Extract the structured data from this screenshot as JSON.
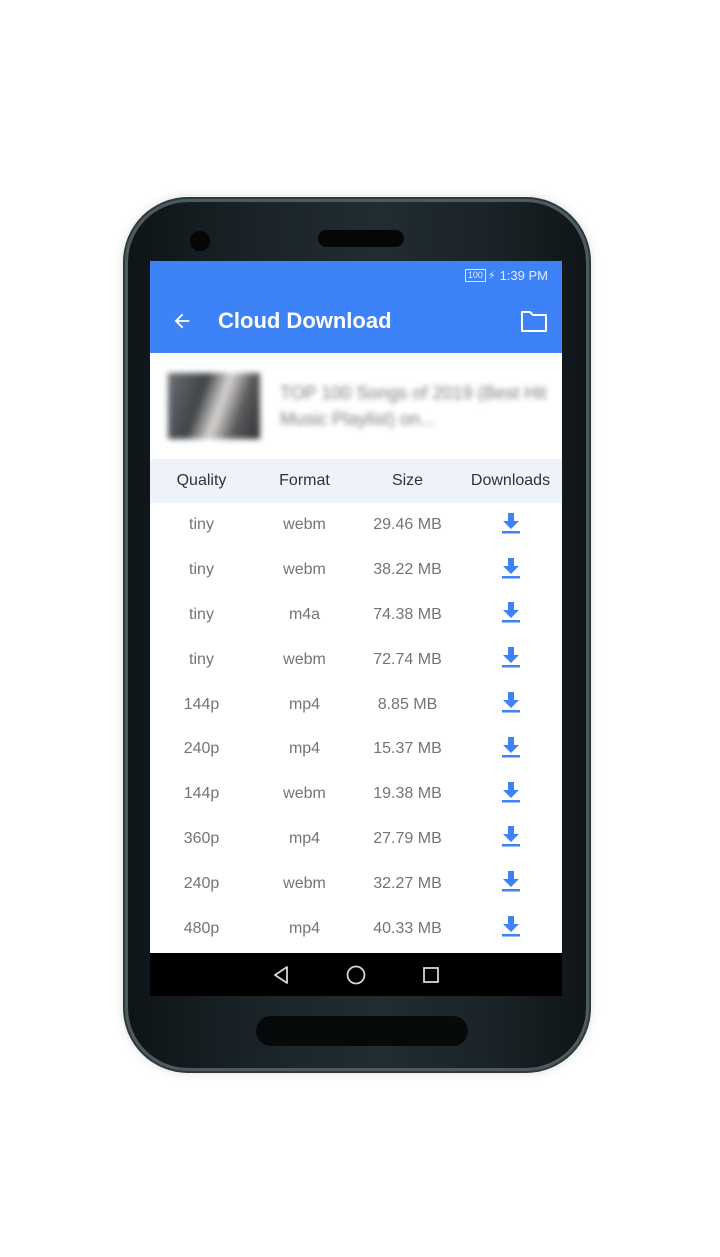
{
  "status_bar": {
    "battery": "100",
    "time": "1:39 PM"
  },
  "app_bar": {
    "title": "Cloud Download",
    "back_icon": "arrow-back-icon",
    "folder_icon": "folder-icon"
  },
  "video": {
    "title": "TOP 100 Songs of 2019 (Best Hit Music Playlist) on..."
  },
  "table": {
    "headers": [
      "Quality",
      "Format",
      "Size",
      "Downloads"
    ],
    "rows": [
      {
        "quality": "tiny",
        "format": "webm",
        "size": "29.46 MB"
      },
      {
        "quality": "tiny",
        "format": "webm",
        "size": "38.22 MB"
      },
      {
        "quality": "tiny",
        "format": "m4a",
        "size": "74.38 MB"
      },
      {
        "quality": "tiny",
        "format": "webm",
        "size": "72.74 MB"
      },
      {
        "quality": "144p",
        "format": "mp4",
        "size": "8.85 MB"
      },
      {
        "quality": "240p",
        "format": "mp4",
        "size": "15.37 MB"
      },
      {
        "quality": "144p",
        "format": "webm",
        "size": "19.38 MB"
      },
      {
        "quality": "360p",
        "format": "mp4",
        "size": "27.79 MB"
      },
      {
        "quality": "240p",
        "format": "webm",
        "size": "32.27 MB"
      },
      {
        "quality": "480p",
        "format": "mp4",
        "size": "40.33 MB"
      }
    ]
  },
  "colors": {
    "accent": "#3e82f7",
    "header_bg": "#eef2f9",
    "nav_bg": "#000000"
  },
  "nav": {
    "back": "nav-back-icon",
    "home": "nav-home-icon",
    "recents": "nav-recents-icon"
  }
}
